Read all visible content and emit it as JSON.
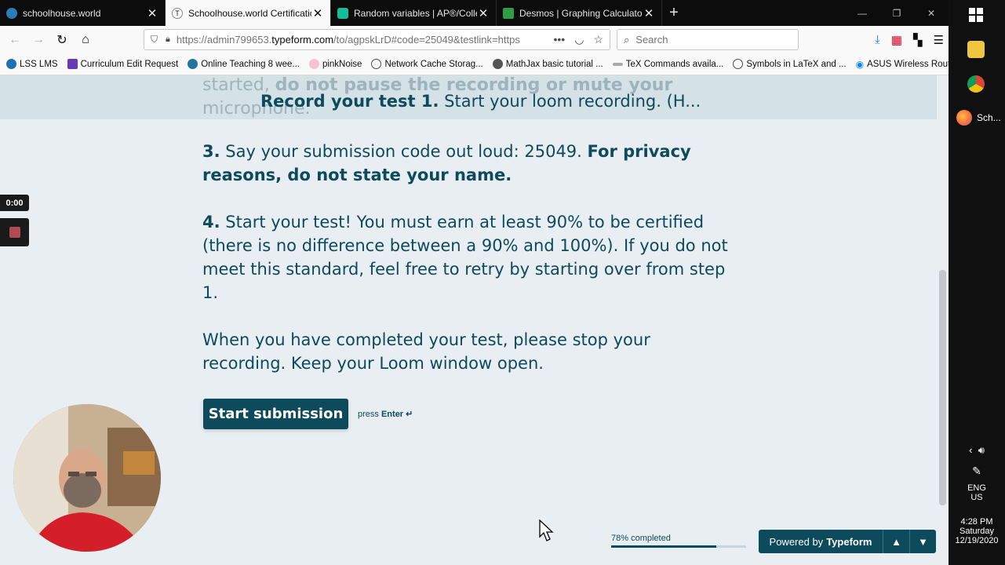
{
  "browser": {
    "tabs": [
      {
        "title": "schoolhouse.world",
        "active": false,
        "color": "#2b7bb9"
      },
      {
        "title": "Schoolhouse.world Certification",
        "active": true,
        "color": "#ffffff"
      },
      {
        "title": "Random variables | AP®/College",
        "active": false,
        "color": "#14bf96"
      },
      {
        "title": "Desmos | Graphing Calculator",
        "active": false,
        "color": "#2f9e44"
      }
    ],
    "url_prefix": "https://admin799653.",
    "url_domain": "typeform.com",
    "url_rest": "/to/agpskLrD#code=25049&testlink=https",
    "search_placeholder": "Search",
    "bookmarks": [
      {
        "label": "LSS LMS",
        "icon": "lms-icon"
      },
      {
        "label": "Curriculum Edit Request",
        "icon": "form-icon"
      },
      {
        "label": "Online Teaching 8 wee...",
        "icon": "wordpress-icon"
      },
      {
        "label": "pinkNoise",
        "icon": "pinknoise-icon"
      },
      {
        "label": "Network Cache Storag...",
        "icon": "globe-icon"
      },
      {
        "label": "MathJax basic tutorial ...",
        "icon": "gear-icon"
      },
      {
        "label": "TeX Commands availa...",
        "icon": "tex-icon"
      },
      {
        "label": "Symbols in LaTeX and ...",
        "icon": "globe-icon"
      },
      {
        "label": "ASUS Wireless Router",
        "icon": "wifi-icon"
      }
    ]
  },
  "form": {
    "sticky_faded_1": "started,",
    "sticky_faded_bold": "do not pause the recording or mute your",
    "sticky_faded_2": "microphone.",
    "sticky_current_bold": "Record your test 1.",
    "sticky_current_text": "Start your loom recording. (H...",
    "step3_num": "3.",
    "step3_text": "Say your submission code out loud: 25049.",
    "step3_bold": "For privacy reasons, do not state your name.",
    "step4_num": "4.",
    "step4_text": "Start your test! You must earn at least 90% to be certified (there is no difference between a 90% and 100%). If you do not meet this standard, feel free to retry by starting over from step 1.",
    "closing": "When you have completed your test, please stop your recording. Keep your Loom window open.",
    "submit_label": "Start submission",
    "press_label": "press",
    "press_key": "Enter ↵",
    "progress_label": "78% completed",
    "progress_value": 0.78,
    "powered_by": "Powered by",
    "powered_brand": "Typeform"
  },
  "loom": {
    "timer": "0:00"
  },
  "taskbar": {
    "firefox_label": "Sch...",
    "lang": "ENG",
    "region": "US",
    "time": "4:28 PM",
    "day": "Saturday",
    "date": "12/19/2020"
  },
  "colors": {
    "accent": "#0d4a5b",
    "page_bg": "#e9eef2"
  }
}
